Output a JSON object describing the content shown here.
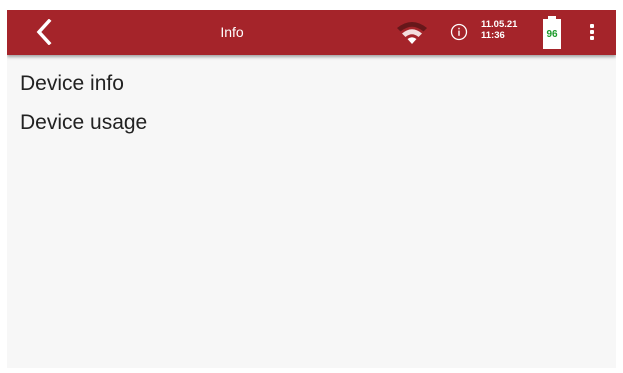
{
  "appbar": {
    "title": "Info",
    "back_icon": "chevron-left-icon",
    "wifi_icon": "wifi-icon",
    "info_icon": "info-icon",
    "menu_icon": "more-vert-icon",
    "background_color": "#a5242a",
    "date": "11.05.21",
    "time": "11:36",
    "battery_level": "96",
    "battery_color": "#1b9a2a"
  },
  "menu": {
    "items": [
      {
        "label": "Device info"
      },
      {
        "label": "Device usage"
      }
    ]
  }
}
